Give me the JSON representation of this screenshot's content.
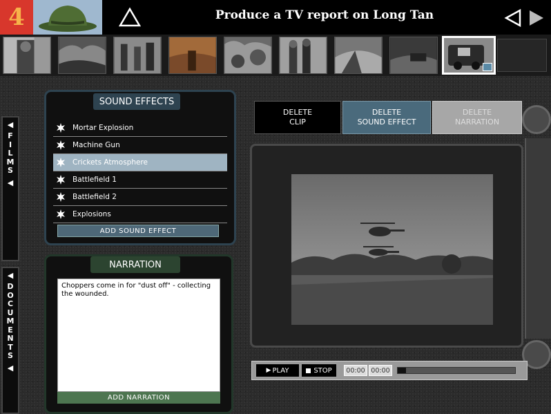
{
  "header": {
    "logo_text": "4",
    "title": "Produce a TV report on Long Tan",
    "home_icon": "triangle-up-outline-icon",
    "prev_icon": "triangle-left-outline-icon",
    "next_icon": "triangle-right-solid-icon"
  },
  "filmstrip": {
    "thumbs": [
      {
        "name": "clip-1",
        "selected": false
      },
      {
        "name": "clip-2",
        "selected": false
      },
      {
        "name": "clip-3",
        "selected": false
      },
      {
        "name": "clip-4",
        "selected": false
      },
      {
        "name": "clip-5",
        "selected": false
      },
      {
        "name": "clip-6",
        "selected": false
      },
      {
        "name": "clip-7",
        "selected": false
      },
      {
        "name": "clip-8",
        "selected": false
      },
      {
        "name": "clip-9",
        "selected": true
      }
    ]
  },
  "side_tabs": {
    "films": "F\nI\nL\nM\nS",
    "documents": "D\nO\nC\nU\nM\nE\nN\nT\nS"
  },
  "sound_effects": {
    "header": "SOUND EFFECTS",
    "items": [
      {
        "label": "Mortar Explosion",
        "active": false
      },
      {
        "label": "Machine Gun",
        "active": false
      },
      {
        "label": "Crickets Atmosphere",
        "active": true
      },
      {
        "label": "Battlefield 1",
        "active": false
      },
      {
        "label": "Battlefield 2",
        "active": false
      },
      {
        "label": "Explosions",
        "active": false
      }
    ],
    "add_label": "ADD SOUND EFFECT"
  },
  "narration": {
    "header": "NARRATION",
    "text": "Choppers come in for \"dust off\" - collecting the wounded.",
    "add_label": "ADD NARRATION"
  },
  "delete_buttons": {
    "clip": "DELETE\nCLIP",
    "sound_effect": "DELETE\nSOUND EFFECT",
    "narration": "DELETE\nNARRATION"
  },
  "player": {
    "play_label": "PLAY",
    "stop_label": "STOP",
    "current_time": "00:00",
    "total_time": "00:00",
    "progress": 0
  },
  "colors": {
    "logo_bg": "#d8372c",
    "logo_fg": "#f7b24a",
    "sfx_accent": "#2e4350",
    "narration_accent": "#2c4430",
    "active_item": "#9fb4c2"
  }
}
